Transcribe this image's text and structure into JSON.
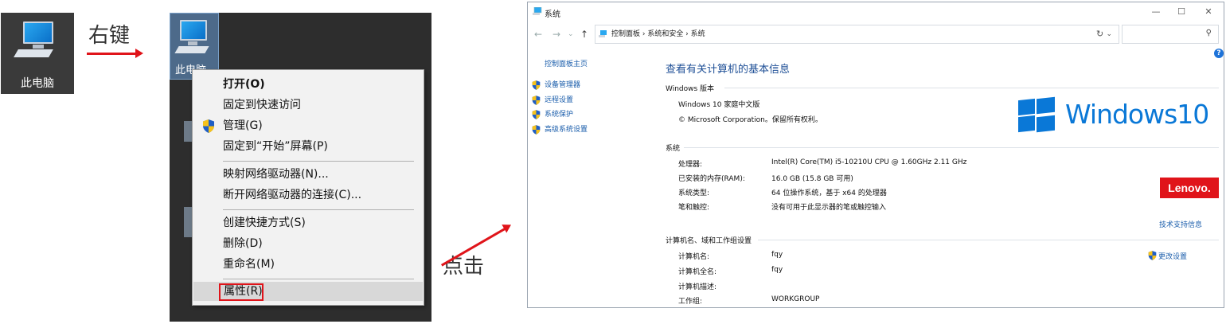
{
  "steps": {
    "right_click": "右键",
    "click": "点击"
  },
  "desktop_icon": {
    "label": "此电脑"
  },
  "context_menu": {
    "items": [
      "打开(O)",
      "固定到快速访问",
      "管理(G)",
      "固定到“开始”屏幕(P)",
      "映射网络驱动器(N)...",
      "断开网络驱动器的连接(C)...",
      "创建快捷方式(S)",
      "删除(D)",
      "重命名(M)",
      "属性(R)"
    ],
    "highlighted": "属性(R)"
  },
  "window": {
    "title": "系统",
    "breadcrumb": "控制面板  ›  系统和安全  ›  系统",
    "controls": {
      "minimize": "—",
      "maximize": "☐",
      "close": "✕"
    },
    "left_nav": {
      "home": "控制面板主页",
      "links": [
        "设备管理器",
        "远程设置",
        "系统保护",
        "高级系统设置"
      ]
    },
    "heading": "查看有关计算机的基本信息",
    "windows_edition": {
      "section": "Windows 版本",
      "edition": "Windows 10 家庭中文版",
      "copyright": "© Microsoft Corporation。保留所有权利。",
      "logo_text": "Windows10"
    },
    "system": {
      "section": "系统",
      "rows": [
        {
          "key": "处理器:",
          "value": "Intel(R) Core(TM) i5-10210U CPU @ 1.60GHz   2.11 GHz"
        },
        {
          "key": "已安装的内存(RAM):",
          "value": "16.0 GB (15.8 GB 可用)"
        },
        {
          "key": "系统类型:",
          "value": "64 位操作系统，基于 x64 的处理器"
        },
        {
          "key": "笔和触控:",
          "value": "没有可用于此显示器的笔或触控输入"
        }
      ],
      "manufacturer_logo": "Lenovo.",
      "support_link": "技术支持信息"
    },
    "computer": {
      "section": "计算机名、域和工作组设置",
      "rows": [
        {
          "key": "计算机名:",
          "value": "fqy"
        },
        {
          "key": "计算机全名:",
          "value": "fqy"
        },
        {
          "key": "计算机描述:",
          "value": ""
        },
        {
          "key": "工作组:",
          "value": "WORKGROUP"
        }
      ],
      "change_link": "更改设置"
    }
  }
}
